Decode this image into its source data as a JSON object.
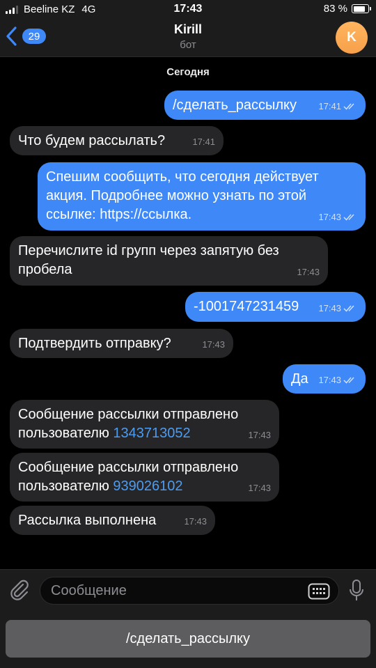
{
  "status_bar": {
    "carrier": "Beeline KZ",
    "network": "4G",
    "time": "17:43",
    "battery": "83 %",
    "battery_level": 0.83
  },
  "header": {
    "back_count": "29",
    "title": "Kirill",
    "subtitle": "бот",
    "avatar_letter": "K",
    "avatar_color": "#f7a04a"
  },
  "chat": {
    "date_label": "Сегодня",
    "messages": [
      {
        "text": "/сделать_рассылку",
        "time": "17:41"
      },
      {
        "text": "Что будем рассылать?",
        "time": "17:41"
      },
      {
        "line1": "Спешим сообщить, что сегодня действует",
        "line2": "акция. Подробнее можно узнать по этой",
        "line3": "ссылке: https://ссылка.",
        "time": "17:43"
      },
      {
        "line1": "Перечислите id групп через запятую без",
        "line2": "пробела",
        "time": "17:43"
      },
      {
        "text": "-1001747231459",
        "time": "17:43"
      },
      {
        "text": "Подтвердить отправку?",
        "time": "17:43"
      },
      {
        "text": "Да",
        "time": "17:43"
      },
      {
        "line1": "Сообщение рассылки отправлено",
        "line2_prefix": "пользователю ",
        "link": "1343713052",
        "time": "17:43"
      },
      {
        "line1": "Сообщение рассылки отправлено",
        "line2_prefix": "пользователю ",
        "link": "939026102",
        "time": "17:43"
      },
      {
        "text": "Рассылка выполнена",
        "time": "17:43"
      }
    ]
  },
  "input": {
    "placeholder": "Сообщение"
  },
  "keyboard": {
    "button_label": "/сделать_рассылку"
  },
  "colors": {
    "outgoing_bubble": "#3e88f7",
    "incoming_bubble": "#262628",
    "link": "#4c9cf2"
  }
}
